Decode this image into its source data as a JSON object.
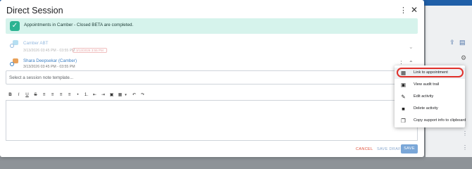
{
  "dialog": {
    "title": "Direct Session",
    "banner_text": "Appointments in Camber - Closed BETA are completed.",
    "session_rows": [
      {
        "name": "Camber ABT",
        "time": "3/13/2026 03:45 PM - 03:55 PM",
        "pill": "3/13/2026 3:55 PM",
        "badge_color": "#7cc6e8"
      },
      {
        "name": "Shara Deepsekar (Camber)",
        "time": "3/13/2026 03:45 PM - 03:55 PM",
        "badge_color": "#e8a15a"
      }
    ],
    "note_placeholder": "Select a session note template...",
    "toolbar": [
      "B",
      "I",
      "U",
      "S",
      "≡",
      "≡",
      "≡",
      "≡",
      "•",
      "1.",
      "⇤",
      "⇥",
      "▣",
      "▦",
      "▾",
      "↶",
      "↷"
    ],
    "footer": {
      "cancel": "CANCEL",
      "save_draft": "SAVE DRAFT",
      "save": "SAVE"
    }
  },
  "menu": {
    "items": [
      {
        "label": "Link to appointment",
        "icon": "calendar-icon"
      },
      {
        "label": "View audit trail",
        "icon": "terminal-icon"
      },
      {
        "label": "Edit activity",
        "icon": "pencil-icon"
      },
      {
        "label": "Delete activity",
        "icon": "trash-icon"
      },
      {
        "label": "Copy support info to clipboard",
        "icon": "copy-icon"
      }
    ]
  },
  "colors": {
    "accent": "#2bb392",
    "highlight_ring": "#e0302a",
    "link": "#3b7fc4"
  }
}
